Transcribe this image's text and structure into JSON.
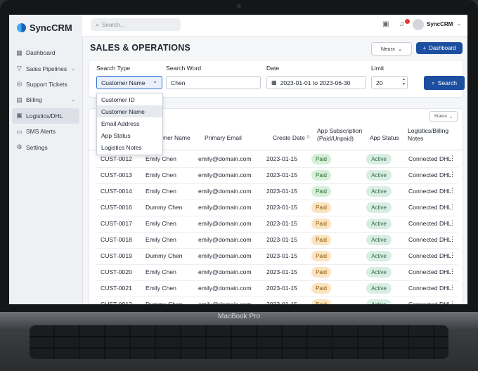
{
  "app": {
    "name": "SyncCRM"
  },
  "sidebar": {
    "items": [
      {
        "label": "Dashboard",
        "icon": "grid-icon"
      },
      {
        "label": "Sales Pipelines",
        "icon": "filter-icon",
        "chevron": true
      },
      {
        "label": "Support Tickets",
        "icon": "ticket-icon"
      },
      {
        "label": "Billing",
        "icon": "billing-icon",
        "chevron": true
      },
      {
        "label": "Logistics/DHL",
        "icon": "truck-icon",
        "active": true
      },
      {
        "label": "SMS Alerts",
        "icon": "chat-icon"
      },
      {
        "label": "Settings",
        "icon": "gear-icon"
      }
    ]
  },
  "header": {
    "search_placeholder": "Search...",
    "user": "SyncCRM"
  },
  "page": {
    "title": "SALES & OPERATIONS",
    "neurx_label": "Neurx",
    "dashboard_label": "Dashboard"
  },
  "filters": {
    "search_type_label": "Search Type",
    "search_type_value": "Customer Name",
    "search_word_label": "Search Word",
    "search_word_value": "Chen",
    "date_label": "Date",
    "date_value": "2023-01-01 to 2023-06-30",
    "limit_label": "Limit",
    "limit_value": "20",
    "search_button": "Search"
  },
  "dropdown": {
    "options": [
      "Customer ID",
      "Customer Name",
      "Email Address",
      "App Status",
      "Logistics Notes"
    ],
    "highlighted": 1
  },
  "table": {
    "status_filter": "Status",
    "headers": {
      "customer_name": "mer Name",
      "email": "Primary Email",
      "create_date": "Create Date",
      "subscription": "App Subscription (Paid/Unpaid)",
      "app_status": "App Status",
      "logistics": "Logistics/Billing Notes"
    },
    "rows": [
      {
        "id": "CUST-0012",
        "name": "Emily Chen",
        "email": "emily@domain.com",
        "date": "2023-01-15",
        "sub": "Paid",
        "sub_style": "green",
        "status": "Active",
        "notes": "Connected DHL"
      },
      {
        "id": "CUST-0013",
        "name": "Emily Chen",
        "email": "emily@domain.com",
        "date": "2023-01-15",
        "sub": "Paid",
        "sub_style": "green",
        "status": "Active",
        "notes": "Connected DHL"
      },
      {
        "id": "CUST-0014",
        "name": "Emily Chen",
        "email": "emily@domain.com",
        "date": "2023-01-15",
        "sub": "Paid",
        "sub_style": "green",
        "status": "Active",
        "notes": "Connected DHL"
      },
      {
        "id": "CUST-0016",
        "name": "Dummy Chen",
        "email": "emily@domain.com",
        "date": "2023-01-15",
        "sub": "Paid",
        "sub_style": "yellow",
        "status": "Active",
        "notes": "Connected DHL"
      },
      {
        "id": "CUST-0017",
        "name": "Emily Chen",
        "email": "emily@domain.com",
        "date": "2023-01-15",
        "sub": "Paid",
        "sub_style": "yellow",
        "status": "Active",
        "notes": "Connected DHL"
      },
      {
        "id": "CUST-0018",
        "name": "Emily Chen",
        "email": "emily@domain.com",
        "date": "2023-01-15",
        "sub": "Paid",
        "sub_style": "yellow",
        "status": "Active",
        "notes": "Connected DHL"
      },
      {
        "id": "CUST-0019",
        "name": "Dummy Chen",
        "email": "emily@domain.com",
        "date": "2023-01-15",
        "sub": "Paid",
        "sub_style": "yellow",
        "status": "Active",
        "notes": "Connected DHL"
      },
      {
        "id": "CUST-0020",
        "name": "Emily Chen",
        "email": "emily@domain.com",
        "date": "2023-01-15",
        "sub": "Paid",
        "sub_style": "yellow",
        "status": "Active",
        "notes": "Connected DHL"
      },
      {
        "id": "CUST-0021",
        "name": "Emily Chen",
        "email": "emily@domain.com",
        "date": "2023-01-15",
        "sub": "Paid",
        "sub_style": "yellow",
        "status": "Active",
        "notes": "Connected DHL"
      },
      {
        "id": "CUST-0012",
        "name": "Dummy Chen",
        "email": "emily@domain.com",
        "date": "2023-01-15",
        "sub": "Baid",
        "sub_style": "yellow",
        "status": "Active",
        "notes": "Connected DHL"
      }
    ]
  },
  "device": {
    "label": "MacBook Pro"
  },
  "colors": {
    "accent": "#1d4fa0",
    "paid_green": "#d5efd9",
    "paid_yellow": "#fbe4bf",
    "active": "#d9eee3"
  }
}
